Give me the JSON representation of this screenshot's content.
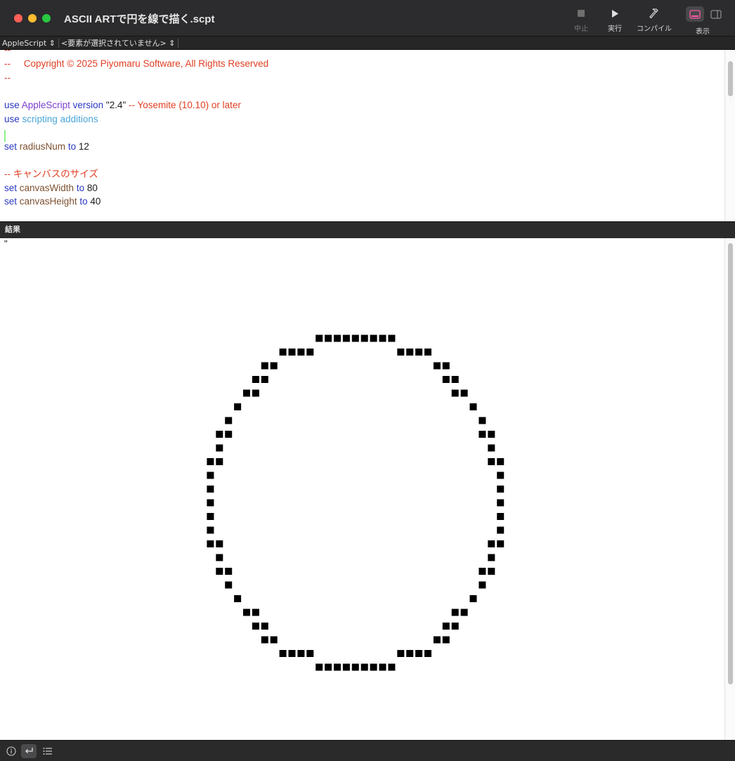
{
  "window": {
    "title": "ASCII ARTで円を線で描く.scpt"
  },
  "toolbar": {
    "stop_label": "中止",
    "run_label": "実行",
    "compile_label": "コンパイル",
    "view_label": "表示"
  },
  "navbar": {
    "language": "AppleScript",
    "element": "<要素が選択されていません>"
  },
  "editor": {
    "line_dash_top": "--",
    "copyright": "--     Copyright © 2025 Piyomaru Software, All Rights Reserved",
    "line_dash_bottom": "--",
    "use_kw": "use",
    "applescript_kw": "AppleScript",
    "version_kw": "version",
    "version_value": "\"2.4\"",
    "version_comment": "-- Yosemite (10.10) or later",
    "use2_kw": "use",
    "scripting_additions": "scripting additions",
    "set1_kw": "set",
    "radius_var": "radiusNum",
    "to1_kw": "to",
    "radius_value": "12",
    "canvas_comment": "-- キャンバスのサイズ",
    "set2_kw": "set",
    "width_var": "canvasWidth",
    "to2_kw": "to",
    "width_value": "80",
    "set3_kw": "set",
    "height_var": "canvasHeight",
    "to3_kw": "to",
    "height_value": "40"
  },
  "result": {
    "header": "結果",
    "quote": "\"",
    "glyph": "■",
    "rows": [
      "             ■■■■■■■■■",
      "         ■■■■         ■■■■",
      "       ■■                 ■■",
      "      ■■                   ■■",
      "     ■■                     ■■",
      "    ■                         ■",
      "   ■                           ■",
      "  ■■                           ■■",
      "  ■                             ■",
      " ■■                             ■■",
      " ■                               ■",
      " ■                               ■",
      " ■                               ■",
      " ■                               ■",
      " ■                               ■",
      " ■■                             ■■",
      "  ■                             ■",
      "  ■■                           ■■",
      "   ■                           ■",
      "    ■                         ■",
      "     ■■                     ■■",
      "      ■■                   ■■",
      "       ■■                 ■■",
      "         ■■■■         ■■■■",
      "             ■■■■■■■■■"
    ]
  }
}
